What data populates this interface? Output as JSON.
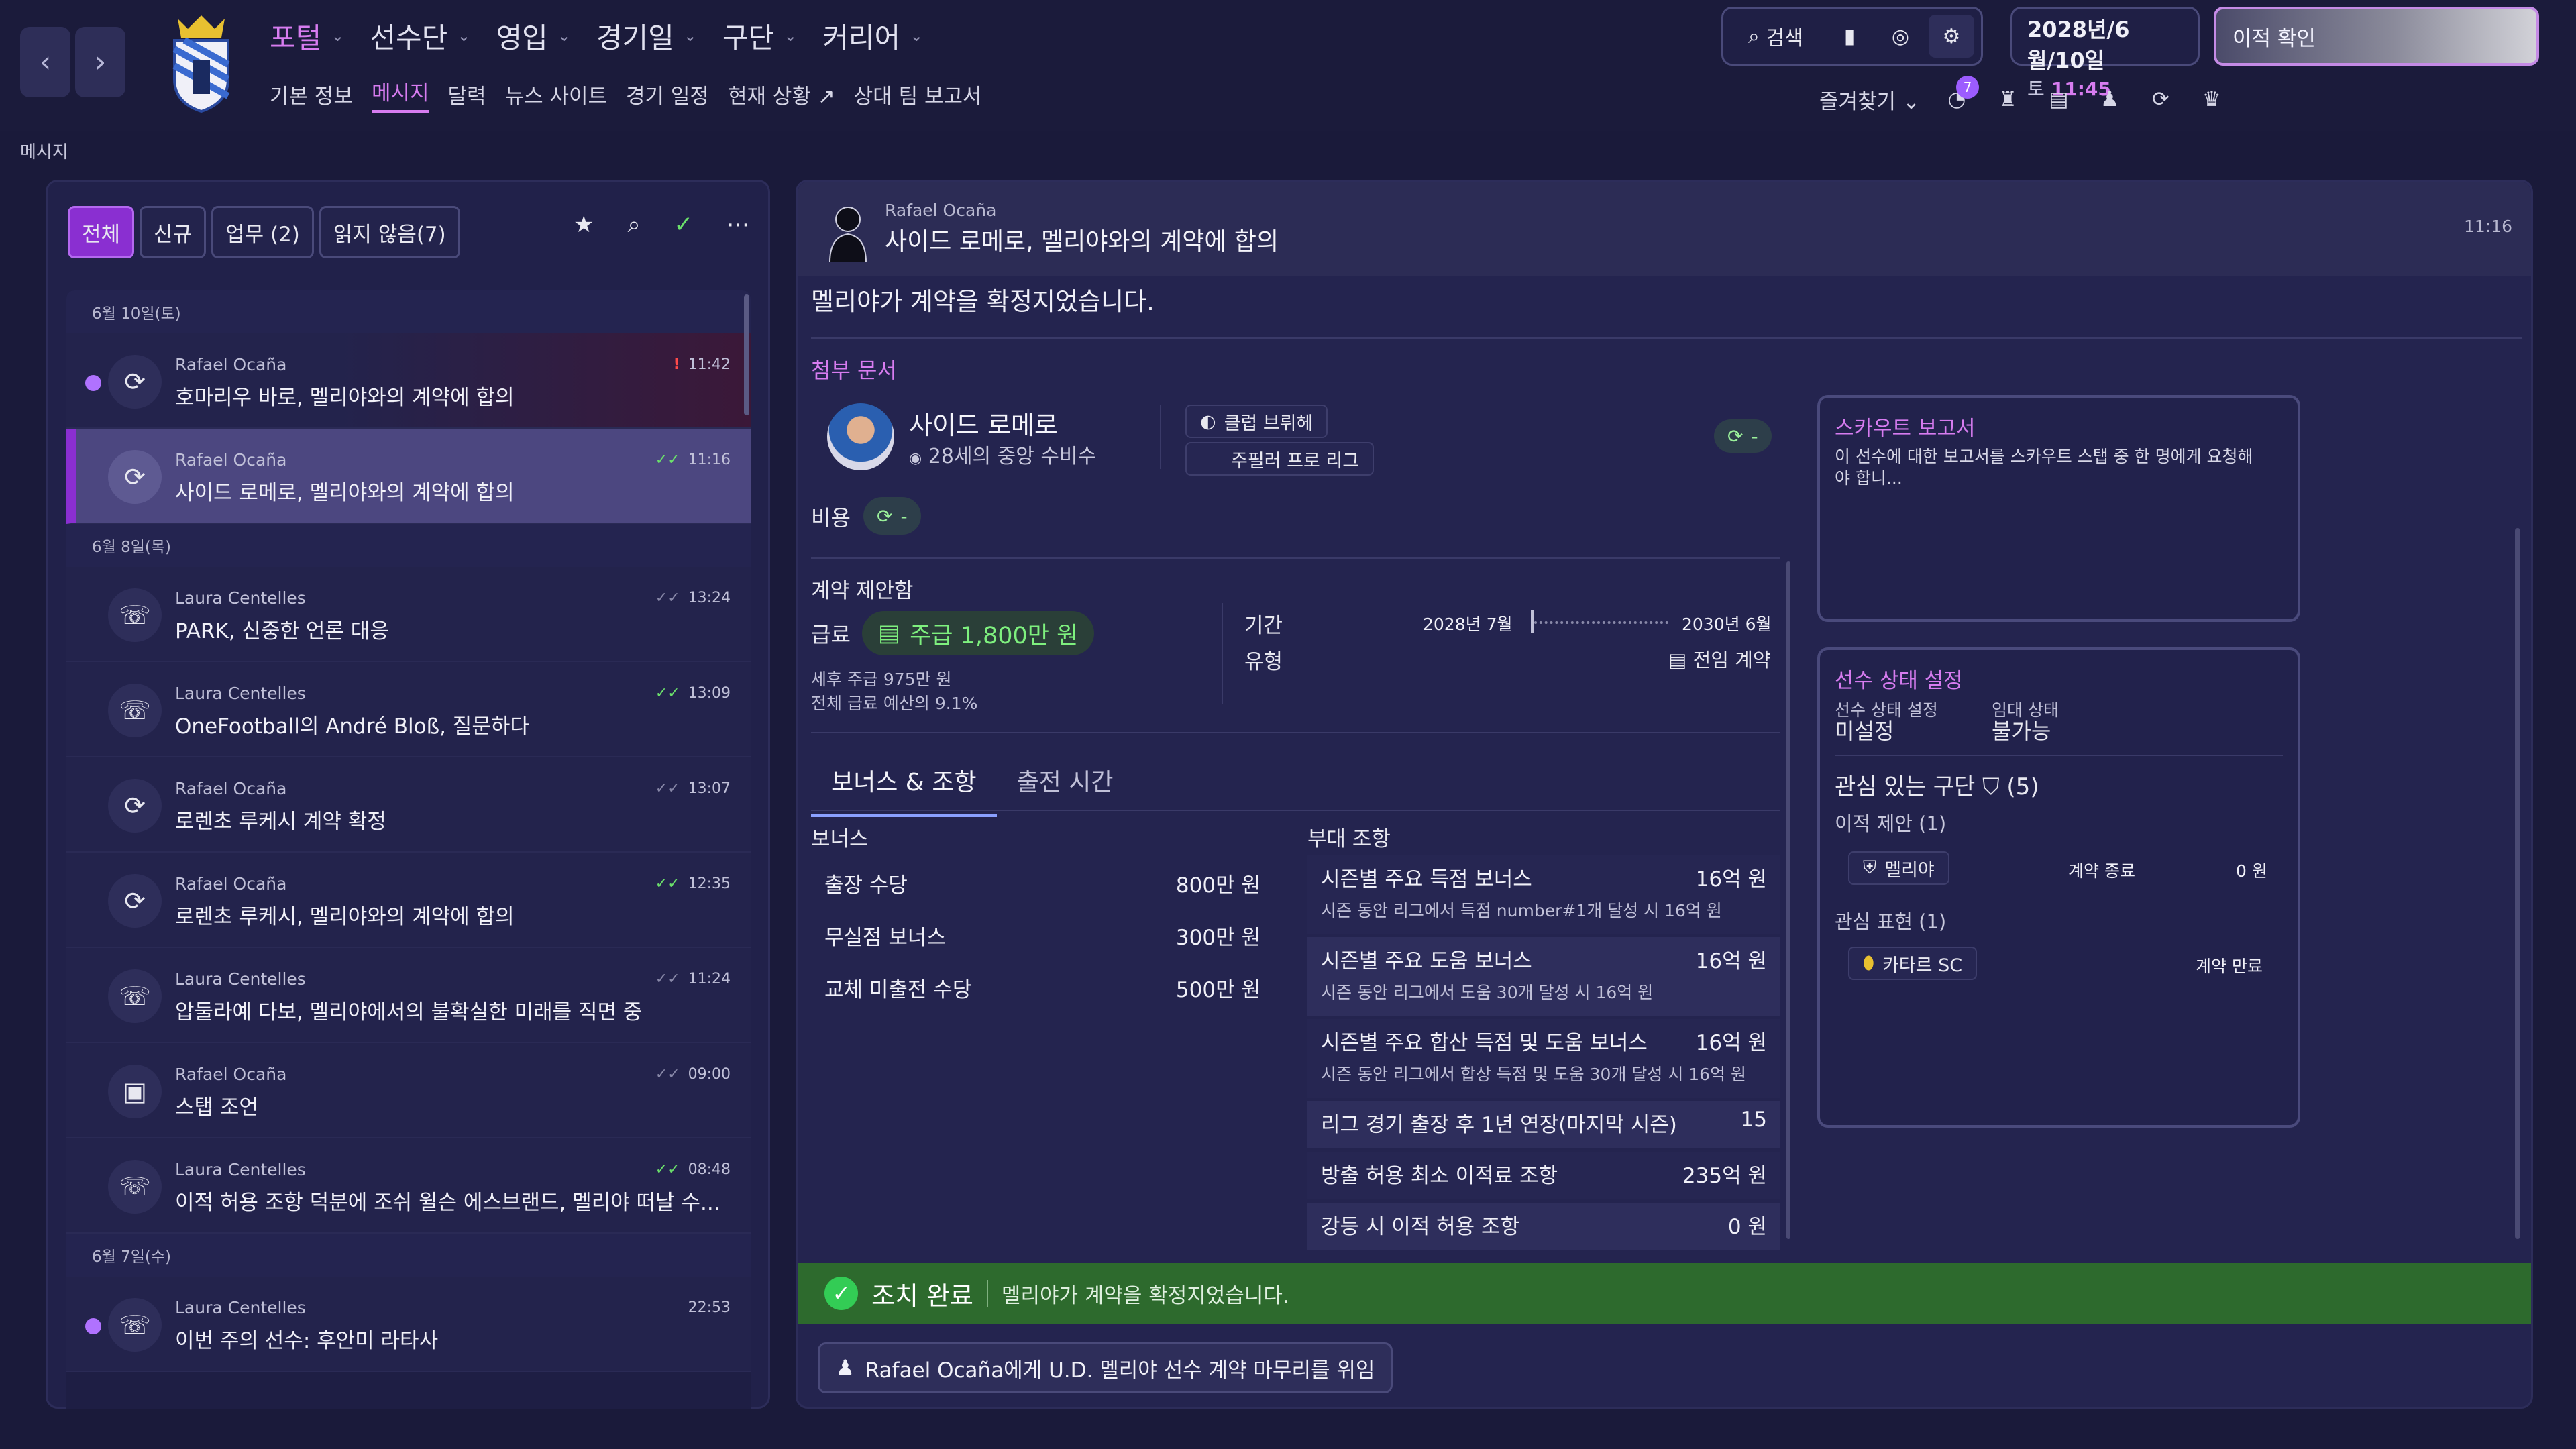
{
  "top_nav": {
    "main_menu": [
      {
        "label": "포털",
        "active": true
      },
      {
        "label": "선수단",
        "active": false
      },
      {
        "label": "영입",
        "active": false
      },
      {
        "label": "경기일",
        "active": false
      },
      {
        "label": "구단",
        "active": false
      },
      {
        "label": "커리어",
        "active": false
      }
    ],
    "sub_menu": [
      "기본 정보",
      "메시지",
      "달력",
      "뉴스 사이트",
      "경기 일정",
      "현재 상황",
      "상대 팀 보고서"
    ],
    "sub_menu_active": "메시지",
    "search_label": "검색",
    "date_line": "2028년/6월/10일",
    "day_label": "토",
    "time_label": "11:45",
    "transfer_button": "이적 확인",
    "favorites_label": "즐겨찾기",
    "notification_count": "7",
    "accent_color": "#d77cf0"
  },
  "page_label": "메시지",
  "inbox": {
    "filters": [
      {
        "label": "전체",
        "active": true
      },
      {
        "label": "신규",
        "active": false
      },
      {
        "label": "업무 (2)",
        "active": false
      },
      {
        "label": "읽지 않음(7)",
        "active": false
      }
    ],
    "groups": [
      {
        "date": "6월 10일(토)",
        "messages": [
          {
            "sender": "Rafael Ocaña",
            "subject": "호마리우 바로, 멜리야와의 계약에 합의",
            "time": "11:42",
            "status": "alert",
            "unread": true,
            "icon": "refresh-icon"
          },
          {
            "sender": "Rafael Ocaña",
            "subject": "사이드 로메로, 멜리야와의 계약에 합의",
            "time": "11:16",
            "status": "done",
            "selected": true,
            "icon": "refresh-icon"
          }
        ]
      },
      {
        "date": "6월 8일(목)",
        "messages": [
          {
            "sender": "Laura Centelles",
            "subject": "PARK, 신중한 언론 대응",
            "time": "13:24",
            "status": "read",
            "icon": "press-icon"
          },
          {
            "sender": "Laura Centelles",
            "subject": "OneFootball의 André Bloß, 질문하다",
            "time": "13:09",
            "status": "done",
            "icon": "press-icon"
          },
          {
            "sender": "Rafael Ocaña",
            "subject": "로렌초 루케시 계약 확정",
            "time": "13:07",
            "status": "read",
            "icon": "refresh-icon"
          },
          {
            "sender": "Rafael Ocaña",
            "subject": "로렌초 루케시, 멜리야와의 계약에 합의",
            "time": "12:35",
            "status": "done",
            "icon": "refresh-icon"
          },
          {
            "sender": "Laura Centelles",
            "subject": "압둘라예 다보, 멜리야에서의 불확실한 미래를 직면 중",
            "time": "11:24",
            "status": "read",
            "icon": "press-icon"
          },
          {
            "sender": "Rafael Ocaña",
            "subject": "스탭 조언",
            "time": "09:00",
            "status": "read",
            "icon": "briefcase-icon"
          },
          {
            "sender": "Laura Centelles",
            "subject": "이적 허용 조항 덕분에 조쉬 윌슨 에스브랜드, 멜리야 떠날 수...",
            "time": "08:48",
            "status": "done",
            "icon": "press-icon"
          }
        ]
      },
      {
        "date": "6월 7일(수)",
        "messages": [
          {
            "sender": "Laura Centelles",
            "subject": "이번 주의 선수: 후안미 라타사",
            "time": "22:53",
            "status": "none",
            "unread": true,
            "icon": "press-icon"
          }
        ]
      }
    ]
  },
  "detail": {
    "sender": "Rafael Ocaña",
    "subject": "사이드 로메로, 멜리야와의 계약에 합의",
    "time": "11:16",
    "body": "멜리야가 계약을 확정지었습니다.",
    "attachments_title": "첨부 문서",
    "player": {
      "name": "사이드 로메로",
      "desc": "28세의 중앙 수비수",
      "club": "클럽 브뤼헤",
      "league": "주필러 프로 리그",
      "value_pill": "-"
    },
    "fee_label": "비용",
    "fee_value": "-",
    "contract": {
      "title": "계약 제안함",
      "wage_label": "급료",
      "wage_value": "주급 1,800만 원",
      "after_tax": "세후 주급 975만 원",
      "budget_share": "전체 급료 예산의 9.1%",
      "period_label": "기간",
      "period_start": "2028년 7월",
      "period_end": "2030년 6월",
      "type_label": "유형",
      "type_value": "전임 계약"
    },
    "tabs": [
      {
        "label": "보너스 & 조항",
        "active": true
      },
      {
        "label": "출전 시간",
        "active": false
      }
    ],
    "bonuses_title": "보너스",
    "bonuses": [
      {
        "label": "출장 수당",
        "value": "800만 원"
      },
      {
        "label": "무실점 보너스",
        "value": "300만 원"
      },
      {
        "label": "교체 미출전 수당",
        "value": "500만 원"
      }
    ],
    "clauses_title": "부대 조항",
    "clauses": [
      {
        "label": "시즌별 주요 득점 보너스",
        "value": "16억 원",
        "sub": "시즌 동안 리그에서 득점 number#1개 달성 시 16억 원"
      },
      {
        "label": "시즌별 주요 도움 보너스",
        "value": "16억 원",
        "sub": "시즌 동안 리그에서 도움 30개 달성 시 16억 원"
      },
      {
        "label": "시즌별 주요 합산 득점 및 도움 보너스",
        "value": "16억 원",
        "sub": "시즌 동안 리그에서 합상 득점 및 도움 30개 달성 시 16억 원"
      },
      {
        "label": "리그 경기 출장 후 1년 연장(마지막 시즌)",
        "value": "15",
        "sub": ""
      },
      {
        "label": "방출 허용 최소 이적료 조항",
        "value": "235억 원",
        "sub": ""
      },
      {
        "label": "강등 시 이적 허용 조항",
        "value": "0 원",
        "sub": ""
      }
    ],
    "scout_card": {
      "title": "스카우트 보고서",
      "text": "이 선수에 대한 보고서를 스카우트 스탭 중 한 명에게 요청해야 합니..."
    },
    "status_card": {
      "title": "선수 상태 설정",
      "status_label": "선수 상태 설정",
      "status_value": "미설정",
      "loan_label": "임대 상태",
      "loan_value": "불가능",
      "interest_title": "관심 있는 구단",
      "interest_count": "(5)",
      "offers_label": "이적 제안 (1)",
      "offer": {
        "club": "멜리야",
        "status": "계약 종료",
        "value": "0 원"
      },
      "interest_label": "관심 표현 (1)",
      "interest": {
        "club": "카타르 SC",
        "status": "계약 만료"
      }
    },
    "action_title": "조치 완료",
    "action_text": "멜리야가 계약을 확정지었습니다.",
    "delegate_button": "Rafael Ocaña에게 U.D. 멜리야 선수 계약 마무리를 위임"
  }
}
